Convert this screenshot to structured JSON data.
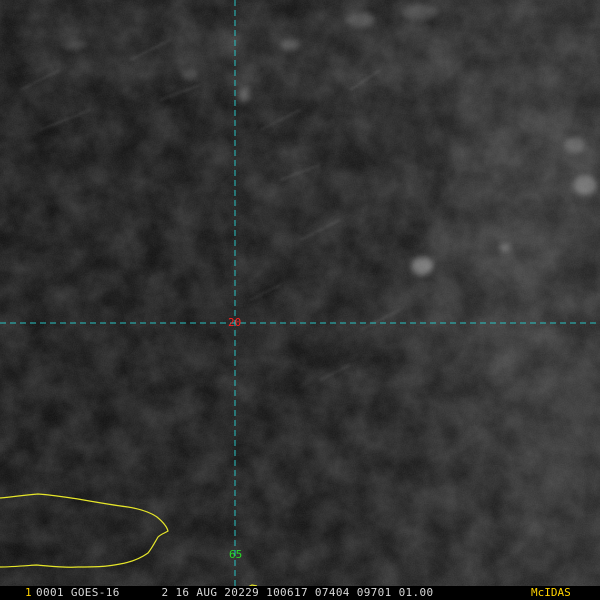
{
  "image": {
    "grid_latitude_label": "20",
    "grid_longitude_label": "65",
    "grid_line_color": "#27c3c3",
    "latitude_label_color": "#ff2020",
    "longitude_label_color": "#28dd28",
    "coastline_color": "#e6e62a",
    "background_color": "#0c0c0c"
  },
  "status_bar": {
    "frame_number": "1",
    "info_text": "0001 GOES-16      2 16 AUG 20229 100617 07404 09701 01.00",
    "brand": "McIDAS",
    "frame_number_color": "#ffd200",
    "text_color": "#d8d8d8",
    "brand_color": "#ffd200"
  }
}
